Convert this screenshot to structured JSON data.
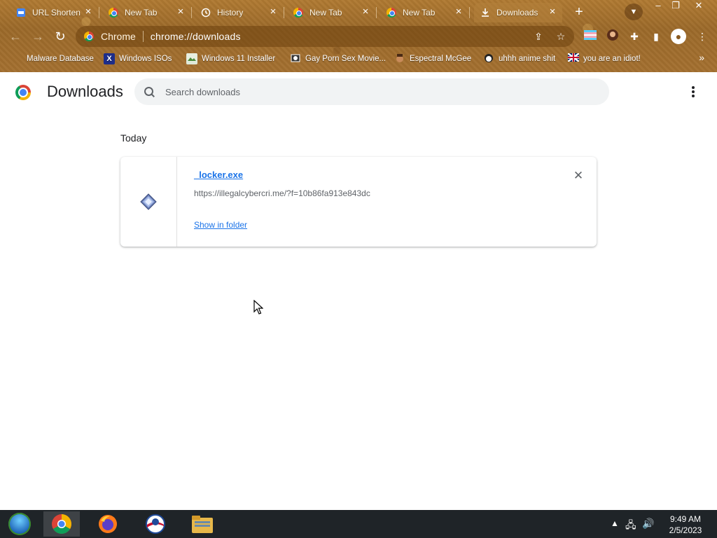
{
  "tabs": [
    {
      "title": "URL Shorten",
      "icon": "docs-icon"
    },
    {
      "title": "New Tab",
      "icon": "chrome-icon"
    },
    {
      "title": "History",
      "icon": "history-icon"
    },
    {
      "title": "New Tab",
      "icon": "chrome-icon"
    },
    {
      "title": "New Tab",
      "icon": "chrome-icon"
    },
    {
      "title": "Downloads",
      "icon": "download-icon"
    }
  ],
  "omnibox": {
    "site_label": "Chrome",
    "url": "chrome://downloads"
  },
  "bookmarks": [
    {
      "label": "Malware Database"
    },
    {
      "label": "Windows ISOs"
    },
    {
      "label": "Windows 11 Installer"
    },
    {
      "label": "Gay Porn Sex Movie..."
    },
    {
      "label": "Espectral McGee"
    },
    {
      "label": "uhhh anime shit"
    },
    {
      "label": "you are an idiot!"
    }
  ],
  "page": {
    "title": "Downloads",
    "search_placeholder": "Search downloads",
    "section": "Today"
  },
  "download": {
    "file_name": "_locker.exe",
    "url": "https://illegalcybercri.me/?f=10b86fa913e843dc",
    "action": "Show in folder"
  },
  "taskbar": {
    "time": "9:49 AM",
    "date": "2/5/2023"
  },
  "colors": {
    "theme": "#a06c2c",
    "link": "#1a73e8",
    "text": "#202124",
    "muted": "#5f6368",
    "taskbar": "#1f2428"
  }
}
